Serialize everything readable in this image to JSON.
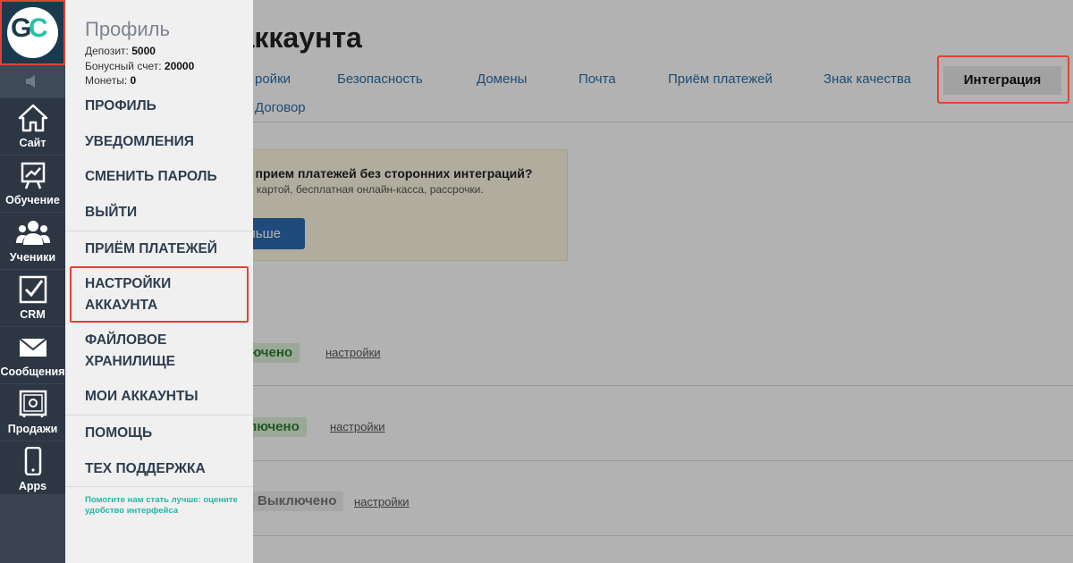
{
  "page": {
    "title": "и аккаунта",
    "tabs": [
      {
        "label": "ройки"
      },
      {
        "label": "Безопасность"
      },
      {
        "label": "Домены"
      },
      {
        "label": "Почта"
      },
      {
        "label": "Приём платежей"
      },
      {
        "label": "Знак качества"
      },
      {
        "label": "Интеграция"
      },
      {
        "label": "Договор"
      }
    ],
    "active_tab": "Интеграция",
    "promo": {
      "title": "рить прием платежей без сторонних интеграций?",
      "subtitle": "ежной картой, бесплатная онлайн-касса, рассрочки.",
      "button_label": "ольше"
    },
    "integrations": [
      {
        "status": "лючено",
        "state": "on",
        "link": "настройки"
      },
      {
        "status": "ключено",
        "state": "on",
        "link": "настройки"
      },
      {
        "status": "Выключено",
        "state": "off",
        "link": "настройки"
      }
    ]
  },
  "iconbar": {
    "logo": {
      "g": "G",
      "c": "C"
    },
    "speaker_icon": "speaker-icon",
    "items": [
      {
        "label": "Сайт",
        "icon": "home-icon",
        "glyph": "⌂"
      },
      {
        "label": "Обучение",
        "icon": "chart-board-icon",
        "glyph": "📈"
      },
      {
        "label": "Ученики",
        "icon": "users-icon",
        "glyph": "👥"
      },
      {
        "label": "CRM",
        "icon": "checkbox-icon",
        "glyph": "☑"
      },
      {
        "label": "Сообщения",
        "icon": "envelope-icon",
        "glyph": "✉"
      },
      {
        "label": "Продажи",
        "icon": "safe-icon",
        "glyph": "▣"
      },
      {
        "label": "Apps",
        "icon": "phone-icon",
        "glyph": "▯"
      }
    ]
  },
  "profile_panel": {
    "title": "Профиль",
    "deposit_label": "Депозит:",
    "deposit_value": "5000",
    "bonus_label": "Бонусный счет:",
    "bonus_value": "20000",
    "coins_label": "Монеты:",
    "coins_value": "0",
    "menu": [
      {
        "label": "ПРОФИЛЬ"
      },
      {
        "label": "УВЕДОМЛЕНИЯ"
      },
      {
        "label": "СМЕНИТЬ ПАРОЛЬ"
      },
      {
        "label": "ВЫЙТИ"
      },
      {
        "label": "ПРИЁМ ПЛАТЕЖЕЙ"
      },
      {
        "label": "НАСТРОЙКИ АККАУНТА"
      },
      {
        "label": "ФАЙЛОВОЕ ХРАНИЛИЩЕ"
      },
      {
        "label": "МОИ АККАУНТЫ"
      },
      {
        "label": "ПОМОЩЬ"
      },
      {
        "label": "ТЕХ ПОДДЕРЖКА"
      }
    ],
    "feedback": "Помогите нам стать лучше: оцените удобство интерфейса"
  },
  "colors": {
    "highlight": "#e04436",
    "accent": "#26c1a8",
    "iconbar": "#3a4452"
  }
}
